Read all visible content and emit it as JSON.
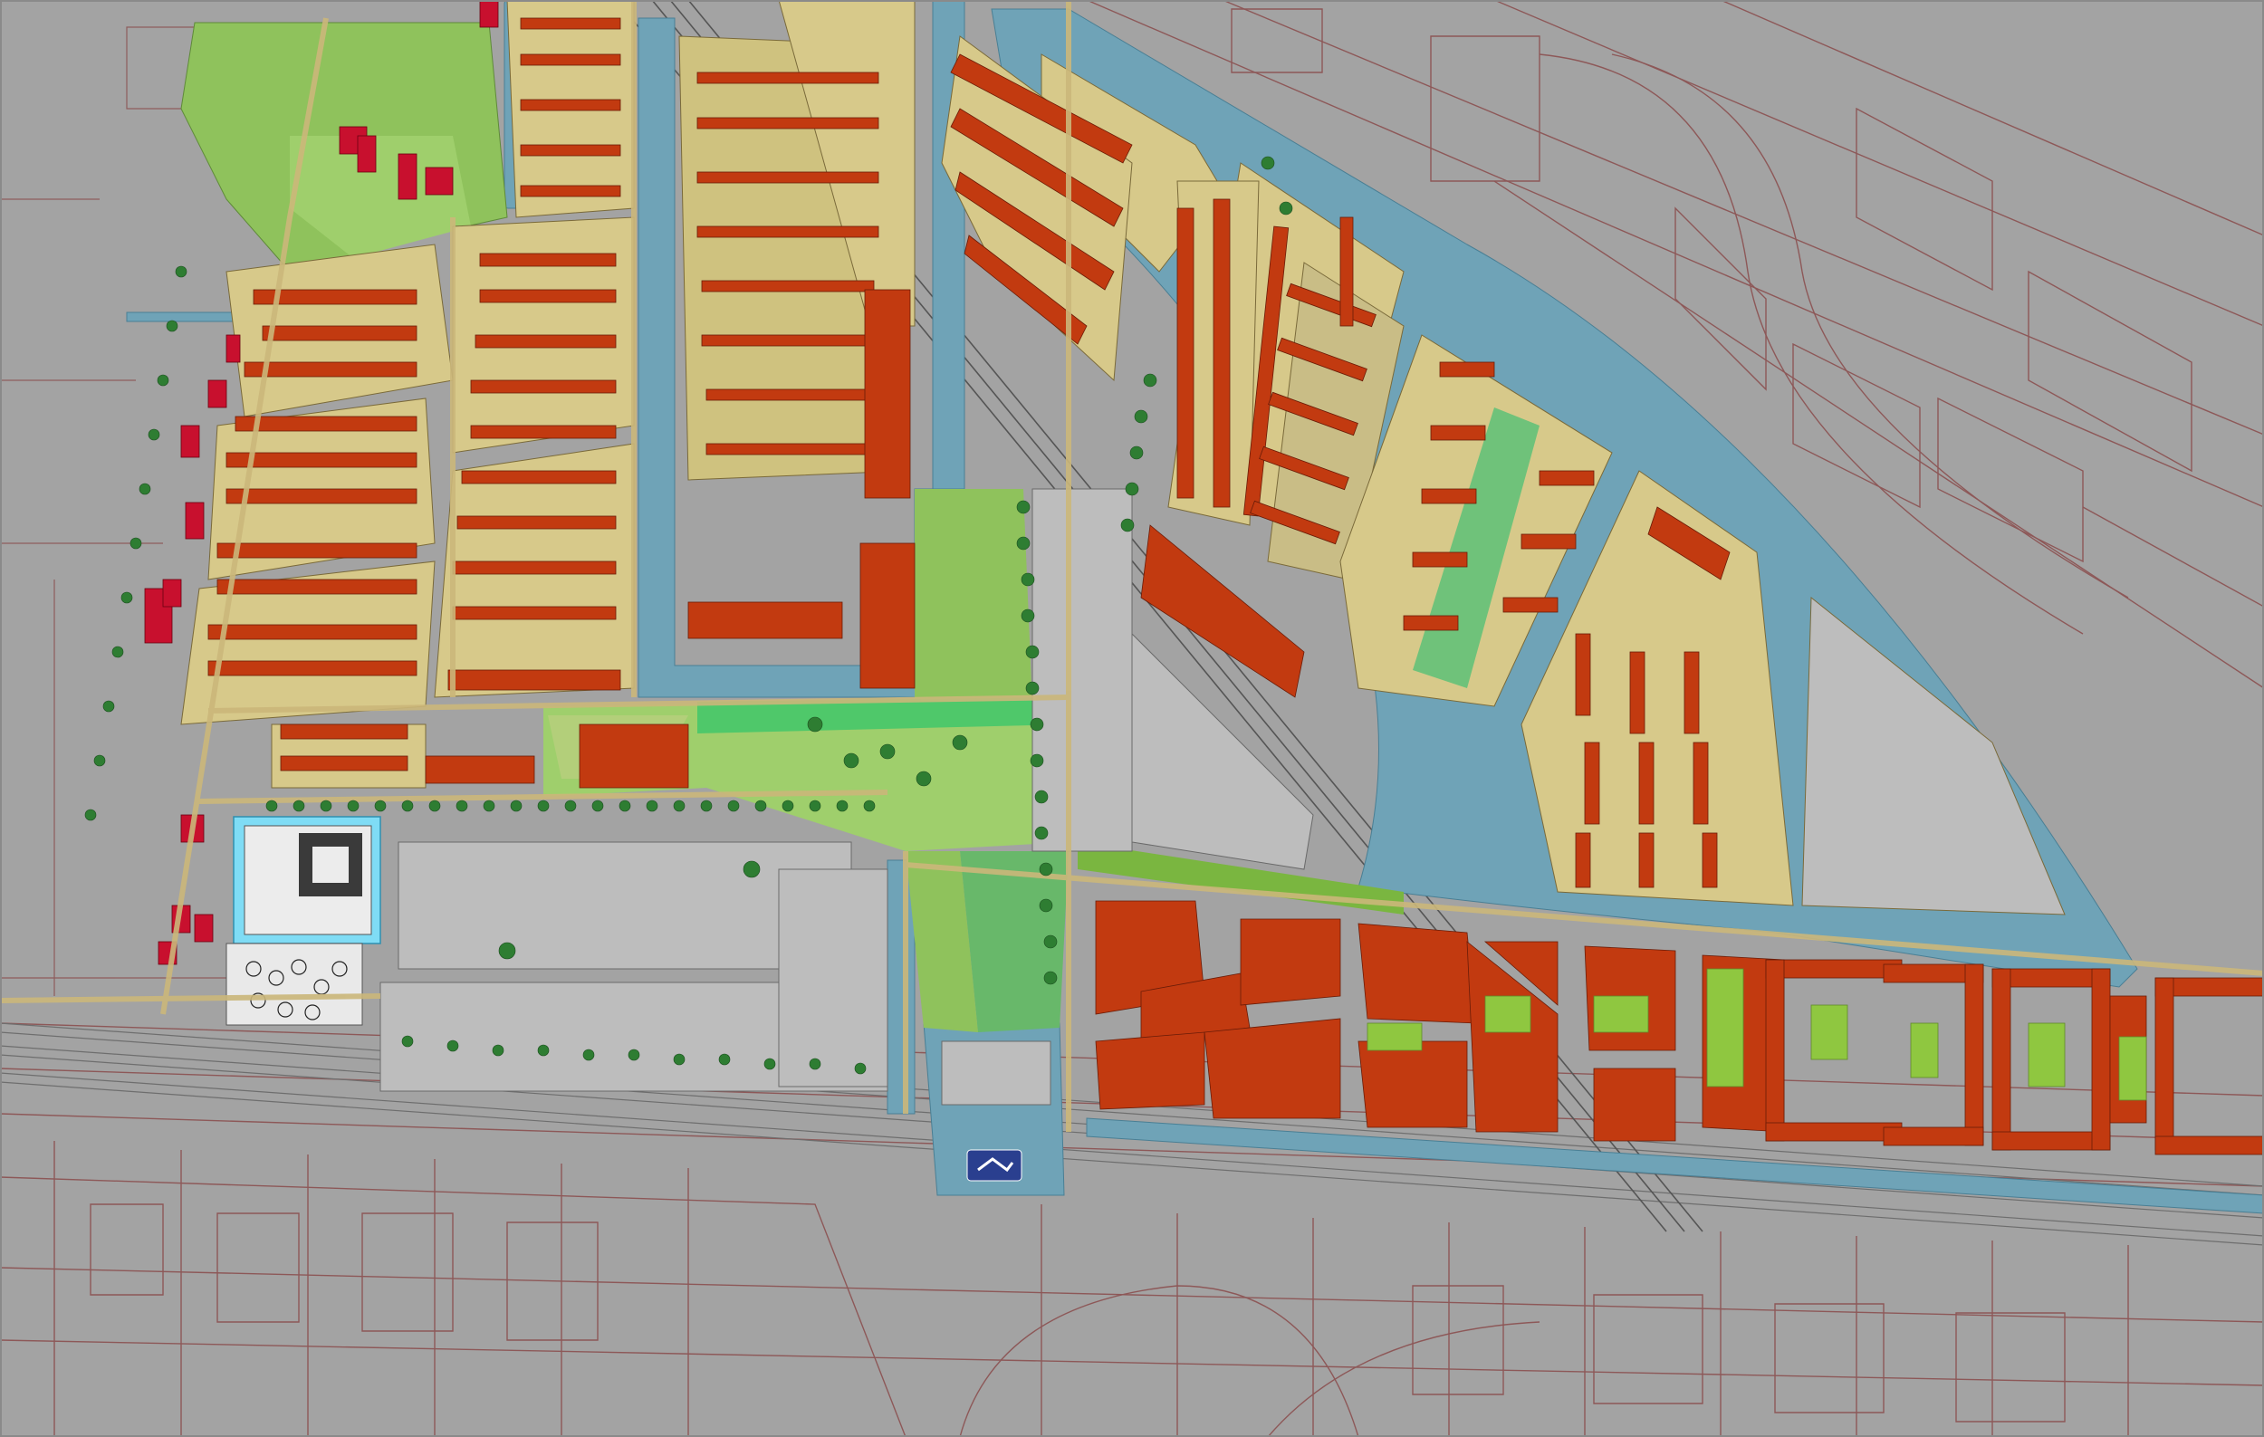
{
  "map": {
    "kind": "urban master plan",
    "labels": [],
    "station_symbol": "railway-station-icon",
    "colors": {
      "background": "#a3a3a3",
      "water": "#6fa3b7",
      "housing_plot": "#d7c98a",
      "building": "#c23a10",
      "green_space": "#8fc25c",
      "tree": "#2e7d32",
      "existing_building": "#c8102e",
      "cadastral_line": "#8a4b4b",
      "road": "#cbb77a",
      "public_building": "#7fdcf5"
    },
    "legend": []
  }
}
